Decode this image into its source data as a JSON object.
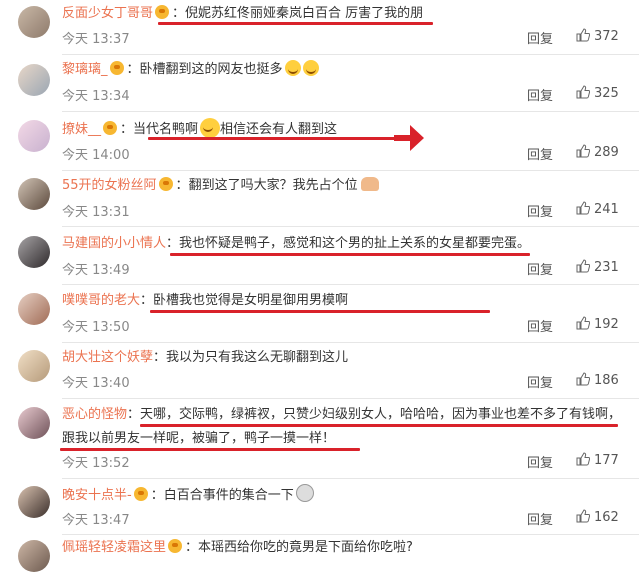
{
  "colors": {
    "name": "#eb7350",
    "underline": "#d9222a",
    "separator": "#e6e6e6"
  },
  "reply_label": "回复",
  "comments": [
    {
      "name": "反面少女丁哥哥",
      "text": "倪妮苏红佟丽娅秦岚白百合 厉害了我的朋",
      "time": "今天 13:37",
      "likes": "372",
      "avatar": "avatar-1"
    },
    {
      "name": "黎璃璃_",
      "text": "卧槽翻到这的网友也挺多",
      "time": "今天 13:34",
      "likes": "325",
      "avatar": "avatar-2"
    },
    {
      "name": "撩妹__",
      "text": "当代名鸭啊",
      "text2": "相信还会有人翻到这",
      "time": "今天 14:00",
      "likes": "289",
      "avatar": "avatar-3"
    },
    {
      "name": "55开的女粉丝阿",
      "text": "翻到这了吗大家？我先占个位",
      "time": "今天 13:31",
      "likes": "241",
      "avatar": "avatar-4"
    },
    {
      "name": "马建国的小小情人",
      "text": "我也怀疑是鸭子，感觉和这个男的扯上关系的女星都要完蛋。",
      "time": "今天 13:49",
      "likes": "231",
      "avatar": "avatar-5"
    },
    {
      "name": "噗噗哥的老大",
      "text": "卧槽我也觉得是女明星御用男模啊",
      "time": "今天 13:50",
      "likes": "192",
      "avatar": "avatar-6"
    },
    {
      "name": "胡大壮这个妖孽",
      "text": "我以为只有我这么无聊翻到这儿",
      "time": "今天 13:40",
      "likes": "186",
      "avatar": "avatar-7"
    },
    {
      "name": "恶心的怪物",
      "text": "天哪，交际鸭，绿裤衩，只赞少妇级别女人，哈哈哈，因为事业也差不多了有钱啊，",
      "text2": "跟我以前男友一样呢，被骗了，鸭子一摸一样！",
      "time": "今天 13:52",
      "likes": "177",
      "avatar": "avatar-8"
    },
    {
      "name": "晚安十点半-",
      "text": "白百合事件的集合一下",
      "time": "今天 13:47",
      "likes": "162",
      "avatar": "avatar-9"
    },
    {
      "name": "佩瑶轻轻凌霜这里",
      "text": "本瑶西给你吃的竟男是下面给你吃啦?",
      "time": "",
      "likes": "",
      "avatar": "avatar-10"
    }
  ]
}
